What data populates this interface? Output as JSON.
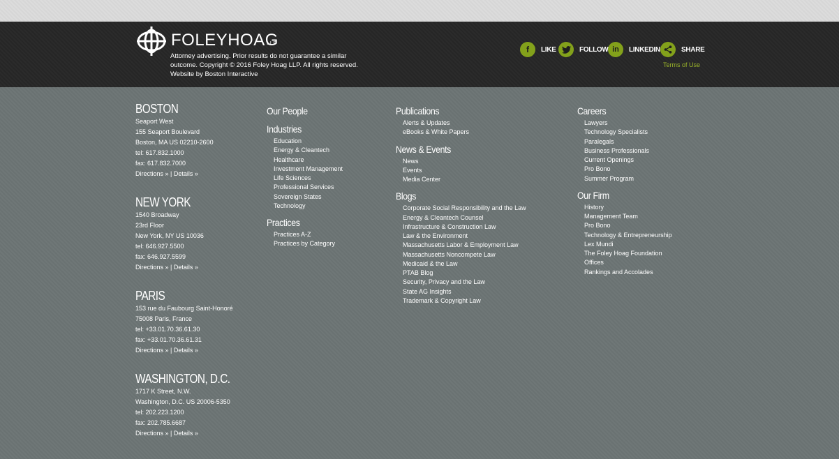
{
  "brand": {
    "name": "FOLEYHOAG",
    "llp": "LLP",
    "disclaimer": "Attorney advertising. Prior results do not guarantee a similar outcome. Copyright © 2016 Foley Hoag LLP. All rights reserved.",
    "credit": "Website by Boston Interactive"
  },
  "social": {
    "like": "LIKE",
    "follow": "FOLLOW",
    "linkedin": "LINKEDIN",
    "share": "SHARE",
    "terms": "Terms of Use"
  },
  "offices": [
    {
      "name": "BOSTON",
      "lines": [
        "Seaport West",
        "155 Seaport Boulevard",
        "Boston, MA US 02210-2600",
        "tel: 617.832.1000",
        "fax: 617.832.7000"
      ],
      "directions": "Directions »",
      "sep": " | ",
      "details": "Details »"
    },
    {
      "name": "NEW YORK",
      "lines": [
        "1540 Broadway",
        "23rd Floor",
        "New York, NY US 10036",
        "tel: 646.927.5500",
        "fax: 646.927.5599"
      ],
      "directions": "Directions »",
      "sep": " | ",
      "details": "Details »"
    },
    {
      "name": "PARIS",
      "lines": [
        "153 rue du Faubourg Saint-Honoré",
        "75008 Paris, France",
        "tel: +33.01.70.36.61.30",
        "fax: +33.01.70.36.61.31"
      ],
      "directions": "Directions »",
      "sep": " | ",
      "details": "Details »"
    },
    {
      "name": "WASHINGTON, D.C.",
      "lines": [
        "1717 K Street, N.W.",
        "Washington, D.C. US 20006-5350",
        "tel: 202.223.1200",
        "fax: 202.785.6687"
      ],
      "directions": "Directions »",
      "sep": " | ",
      "details": "Details »"
    }
  ],
  "nav": {
    "our_people": "Our People",
    "industries": {
      "title": "Industries",
      "items": [
        "Education",
        "Energy & Cleantech",
        "Healthcare",
        "Investment Management",
        "Life Sciences",
        "Professional Services",
        "Sovereign States",
        "Technology"
      ]
    },
    "practices": {
      "title": "Practices",
      "items": [
        "Practices A-Z",
        "Practices by Category"
      ]
    },
    "publications": {
      "title": "Publications",
      "items": [
        "Alerts & Updates",
        "eBooks & White Papers"
      ]
    },
    "news_events": {
      "title": "News & Events",
      "items": [
        "News",
        "Events",
        "Media Center"
      ]
    },
    "blogs": {
      "title": "Blogs",
      "items": [
        "Corporate Social Responsibility and the Law",
        "Energy & Cleantech Counsel",
        "Infrastructure & Construction Law",
        "Law & the Environment",
        "Massachusetts Labor & Employment Law",
        "Massachusetts Noncompete Law",
        "Medicaid & the Law",
        "PTAB Blog",
        "Security, Privacy and the Law",
        "State AG Insights",
        "Trademark & Copyright Law"
      ]
    },
    "careers": {
      "title": "Careers",
      "items": [
        "Lawyers",
        "Technology Specialists",
        "Paralegals",
        "Business Professionals",
        "Current Openings",
        "Pro Bono",
        "Summer Program"
      ]
    },
    "our_firm": {
      "title": "Our Firm",
      "items": [
        "History",
        "Management Team",
        "Pro Bono",
        "Technology & Entrepreneurship",
        "Lex Mundi",
        "The Foley Hoag Foundation",
        "Offices",
        "Rankings and Accolades"
      ]
    }
  },
  "colors": {
    "accent": "#83a11b",
    "link_green": "#9bb52a",
    "header_bg": "#282828",
    "main_bg": "#6b7373"
  }
}
